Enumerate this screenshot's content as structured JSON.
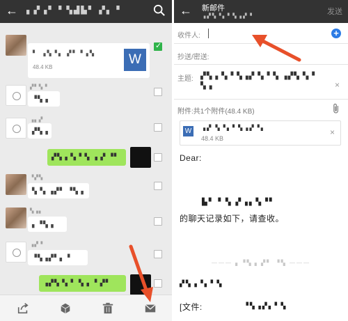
{
  "left_pane": {
    "header": {
      "back_icon": "arrow-left-icon",
      "title": "▖▞▗▘▝ ▚▟▙▘ ▞▖▝",
      "search_icon": "search-icon"
    },
    "file_message": {
      "name": "▘ ▗▚▝▖ ▞▘▝▗▚",
      "size": "48.4 KB",
      "icon_letter": "W"
    },
    "messages": [
      {
        "sender": "▞▘▚▝",
        "text": "▝▚▗",
        "side": "left"
      },
      {
        "sender": "▗▖▞",
        "text": "▞▚▗",
        "side": "left"
      },
      {
        "sender": "",
        "text": "▞▚▗▝▖▘▚ ▗ ▞ ▝▘",
        "side": "right"
      },
      {
        "sender": "▝▞▚",
        "text": "▚▝▖▗▞▘ ▝▚▗",
        "side": "left"
      },
      {
        "sender": "▚▗▖",
        "text": "▖▝▚▗",
        "side": "left"
      },
      {
        "sender": "▗▞▝",
        "text": "▝▚▗▞▘▖▝",
        "side": "left"
      },
      {
        "sender": "",
        "text": "▗▞▚▝▖▘ ▚▗ ▝ ▞▘",
        "side": "right"
      }
    ],
    "footer_icons": [
      "share-icon",
      "box-icon",
      "trash-icon",
      "mail-icon"
    ]
  },
  "right_pane": {
    "header": {
      "back_icon": "arrow-left-icon",
      "title": "新邮件",
      "subtitle": "▗▞▚▝▖▘▚▗▞▝",
      "send_label": "发送"
    },
    "to_label": "收件人:",
    "cc_label": "抄送/密送:",
    "subject_label": "主题:",
    "subject_value": "▞▚▗▝▖▘▚▗▞▝▖▘▚ ▗▞▚▝▖▘ ▚▗",
    "attachment_label": "附件:共1个附件(48.4 KB)",
    "attachment": {
      "icon_letter": "W",
      "name": "▗▞ ▚▝▖▘▚▗▞▝▖",
      "size": "48.4 KB"
    },
    "body": {
      "greeting": "Dear:",
      "line1_blurred": "▙▘▝ ▚ ▞▗▖▚▝▘",
      "line2": "的聊天记录如下，请查收。",
      "divider_text": "——— ▖▝▚▗ ▞▘ ▝▚ ———",
      "line3_blurred": "▞▚▗▝▖▘▚",
      "file_prefix": "[文件:",
      "file_blurred": "▝▚▗▞▖▘▚"
    }
  },
  "colors": {
    "header_bg": "#333333",
    "check_green": "#2fb34a",
    "bubble_green": "#9fe55c",
    "word_blue": "#3b6db5",
    "plus_blue": "#2c7be5",
    "arrow_red": "#e8502a"
  }
}
